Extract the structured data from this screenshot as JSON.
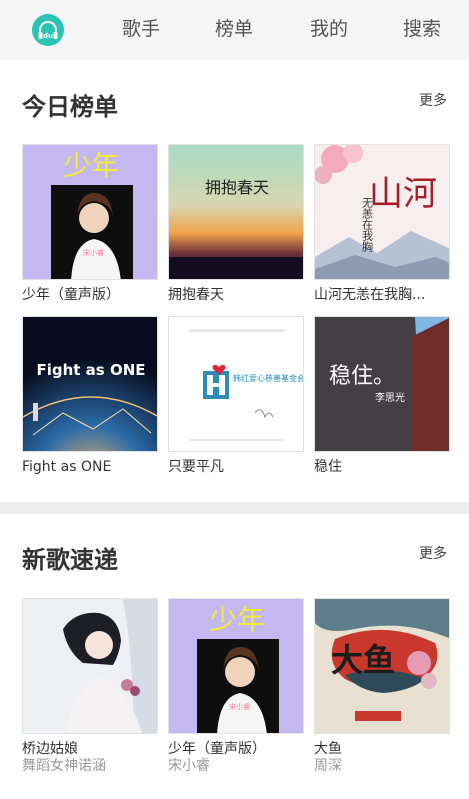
{
  "app": {
    "logo_text": "du",
    "accent_color": "#2bc4b3",
    "nav": [
      {
        "label": "歌手"
      },
      {
        "label": "榜单"
      },
      {
        "label": "我的"
      },
      {
        "label": "搜索"
      }
    ]
  },
  "today_chart": {
    "title": "今日榜单",
    "more": "更多",
    "items": [
      {
        "title": "少年（童声版）",
        "cover_text": "少年",
        "cover_caption": "宋小睿"
      },
      {
        "title": "拥抱春天",
        "cover_text": "拥抱春天"
      },
      {
        "title": "山河无恙在我胸...",
        "cover_text": "山河",
        "cover_subtext": "无恙在我胸"
      },
      {
        "title": "Fight as ONE",
        "cover_text": "Fight as ONE"
      },
      {
        "title": "只要平凡",
        "cover_text": "韩红爱心慈善基金会"
      },
      {
        "title": "稳住",
        "cover_text": "稳住。",
        "cover_caption": "李思光"
      }
    ]
  },
  "new_songs": {
    "title": "新歌速递",
    "more": "更多",
    "items": [
      {
        "title": "桥边姑娘",
        "artist": "舞蹈女神诺涵"
      },
      {
        "title": "少年（童声版）",
        "artist": "宋小睿",
        "cover_text": "少年",
        "cover_caption": "宋小睿"
      },
      {
        "title": "大鱼",
        "artist": "周深",
        "cover_text": "大鱼"
      }
    ]
  }
}
